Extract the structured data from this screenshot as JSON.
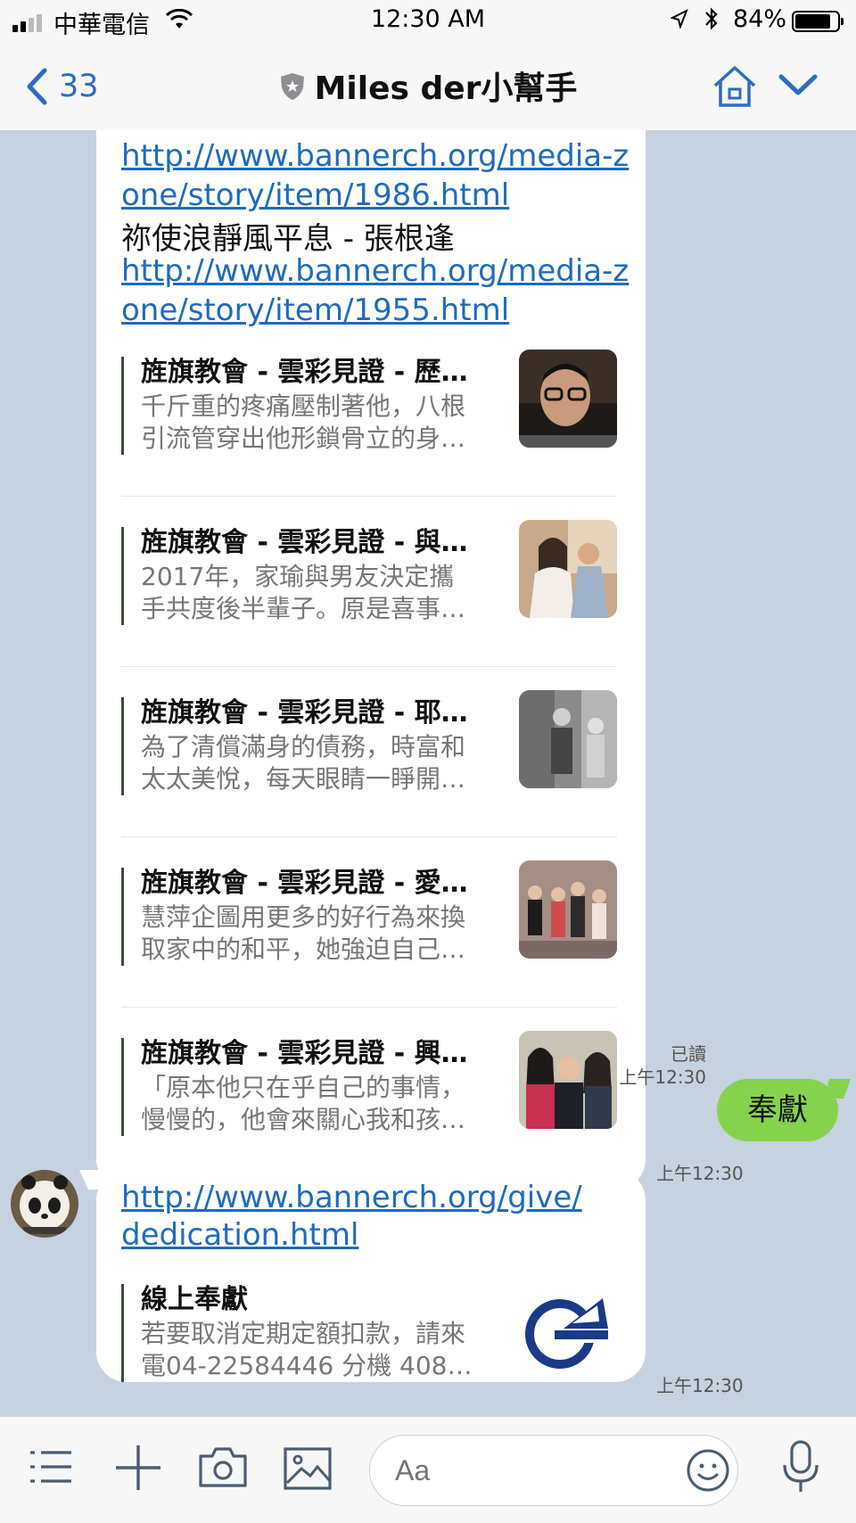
{
  "status_bar": {
    "carrier": "中華電信",
    "time": "12:30 AM",
    "battery": "84%",
    "battery_level": 0.84
  },
  "nav": {
    "back_count": "33",
    "title": "Miles der小幫手"
  },
  "messages": {
    "first": {
      "link1": "http://www.bannerch.org/media-zone/story/item/1986.html",
      "text1": "祢使浪靜風平息 - 張根逢",
      "link2": "http://www.bannerch.org/media-zone/story/item/1955.html",
      "cards": [
        {
          "title": "旌旗教會 - 雲彩見證 - 歷…",
          "desc1": "千斤重的疼痛壓制著他，八根",
          "desc2": "引流管穿出他形鎖骨立的身…"
        },
        {
          "title": "旌旗教會 - 雲彩見證 - 與…",
          "desc1": "2017年，家瑜與男友決定攜",
          "desc2": "手共度後半輩子。原是喜事…"
        },
        {
          "title": "旌旗教會 - 雲彩見證 - 耶…",
          "desc1": "為了清償滿身的債務，時富和",
          "desc2": "太太美悅，每天眼睛一睜開…"
        },
        {
          "title": "旌旗教會 - 雲彩見證 - 愛…",
          "desc1": "慧萍企圖用更多的好行為來換",
          "desc2": "取家中的和平，她強迫自己…"
        },
        {
          "title": "旌旗教會 - 雲彩見證 - 興…",
          "desc1": "「原本他只在乎自己的事情，",
          "desc2": "慢慢的，他會來關心我和孩…"
        }
      ],
      "time": "上午12:30"
    },
    "sent": {
      "text": "奉獻",
      "read": "已讀",
      "time": "上午12:30"
    },
    "second": {
      "link": "http://www.bannerch.org/give/dedication.html",
      "link_line1": "http://www.bannerch.org/give/",
      "link_line2": "dedication.html",
      "card_title": "線上奉獻",
      "card_desc1": "若要取消定期定額扣款，請來",
      "card_desc2": "電04-22584446 分機 408…",
      "time": "上午12:30"
    }
  },
  "input": {
    "placeholder": "Aa"
  },
  "icons": [
    "back-chevron-icon",
    "shield-icon",
    "home-icon",
    "chevron-down-icon",
    "menu-icon",
    "plus-icon",
    "camera-icon",
    "image-icon",
    "smile-icon",
    "microphone-icon"
  ],
  "colors": {
    "chat_bg": "#c6d2e0",
    "link": "#1f6bbf",
    "accent": "#2d6cc0",
    "sent_bubble": "#85d34c"
  }
}
